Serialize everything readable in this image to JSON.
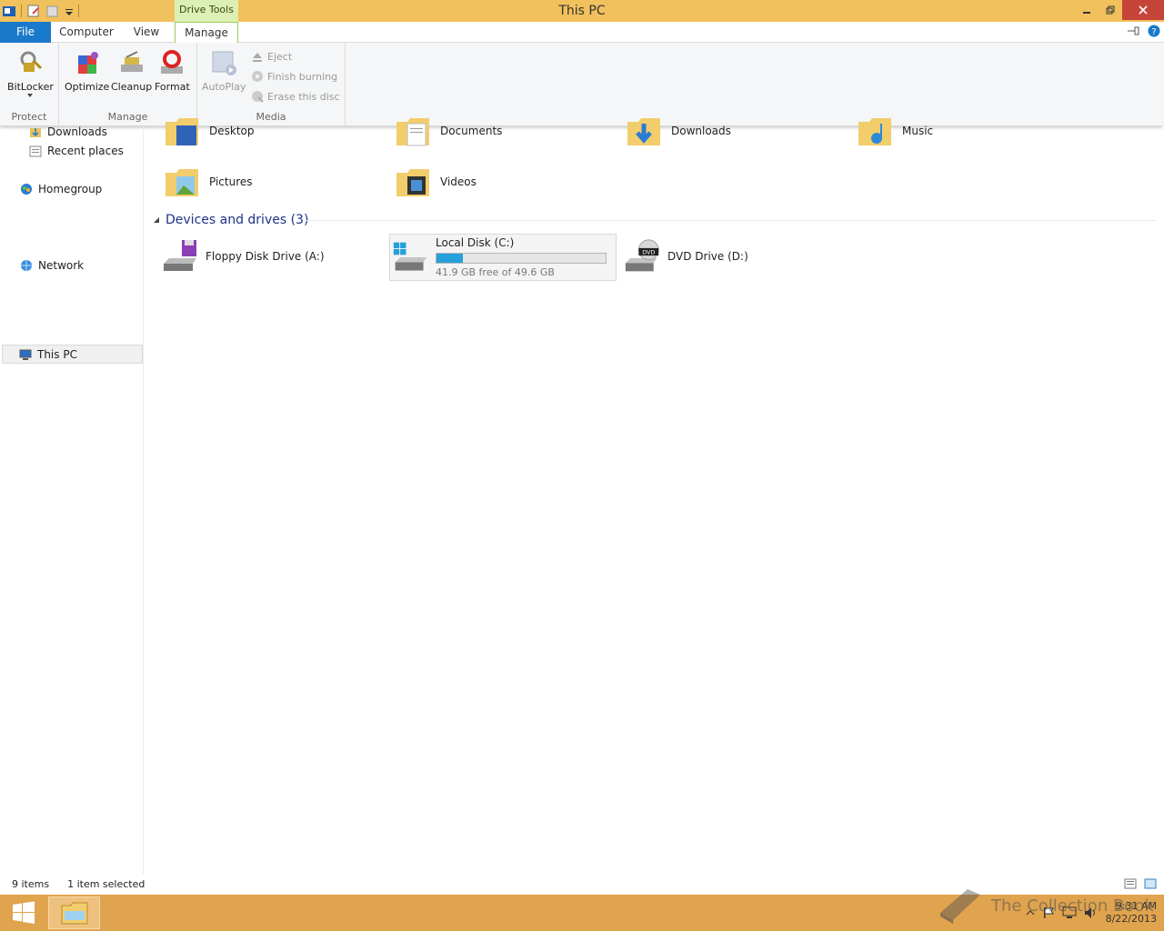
{
  "window": {
    "title": "This PC",
    "contextual_tab_group": "Drive Tools"
  },
  "tabs": {
    "file": "File",
    "computer": "Computer",
    "view": "View",
    "manage": "Manage"
  },
  "ribbon": {
    "protect": {
      "name": "Protect",
      "bitlocker": "BitLocker"
    },
    "manage": {
      "name": "Manage",
      "optimize": "Optimize",
      "cleanup": "Cleanup",
      "format": "Format"
    },
    "media": {
      "name": "Media",
      "autoplay": "AutoPlay",
      "eject": "Eject",
      "finish_burning": "Finish burning",
      "erase_disc": "Erase this disc"
    }
  },
  "nav": {
    "items": [
      "Downloads",
      "Recent places",
      "Homegroup",
      "This PC",
      "Network"
    ]
  },
  "folders": [
    "Desktop",
    "Documents",
    "Downloads",
    "Music",
    "Pictures",
    "Videos"
  ],
  "devices": {
    "header": "Devices and drives (3)",
    "floppy": "Floppy Disk Drive (A:)",
    "local": {
      "name": "Local Disk (C:)",
      "free": "41.9 GB free of 49.6 GB",
      "used_fraction": 0.155
    },
    "dvd": "DVD Drive (D:)"
  },
  "status": {
    "count": "9 items",
    "selected": "1 item selected"
  },
  "taskbar": {
    "time": "9:31 AM",
    "date": "8/22/2013"
  },
  "watermark": "The Collection Book",
  "colors": {
    "titlebar": "#f1c15d",
    "file_tab": "#1979ca",
    "taskbar": "#e0a34e",
    "capacity": "#26a0da"
  }
}
